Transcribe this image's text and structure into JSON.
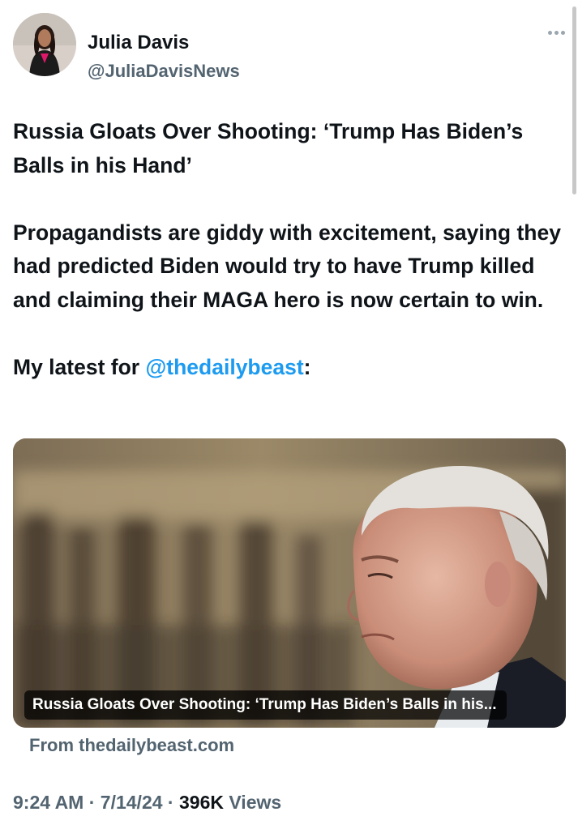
{
  "author": {
    "display_name": "Julia Davis",
    "handle": "@JuliaDavisNews",
    "avatar_icon": "profile-photo"
  },
  "tweet": {
    "paragraph_1": "Russia Gloats Over Shooting: ‘Trump Has Biden’s Balls in his Hand’",
    "paragraph_2": "Propagandists are giddy with excitement, saying they had predicted Biden would try to have Trump killed and claiming their MAGA hero is now certain to win.",
    "paragraph_3_prefix": "My latest for ",
    "mention": "@thedailybeast",
    "paragraph_3_suffix": ":"
  },
  "link_card": {
    "title": "Russia Gloats Over Shooting: ‘Trump Has Biden’s Balls in his...",
    "source": "From thedailybeast.com"
  },
  "meta": {
    "time": "9:24 AM",
    "separator_1": " · ",
    "date": "7/14/24",
    "separator_2": " · ",
    "views_count": "396K",
    "views_label": " Views"
  },
  "colors": {
    "text": "#0f1419",
    "secondary": "#536471",
    "link": "#1d9bf0"
  }
}
